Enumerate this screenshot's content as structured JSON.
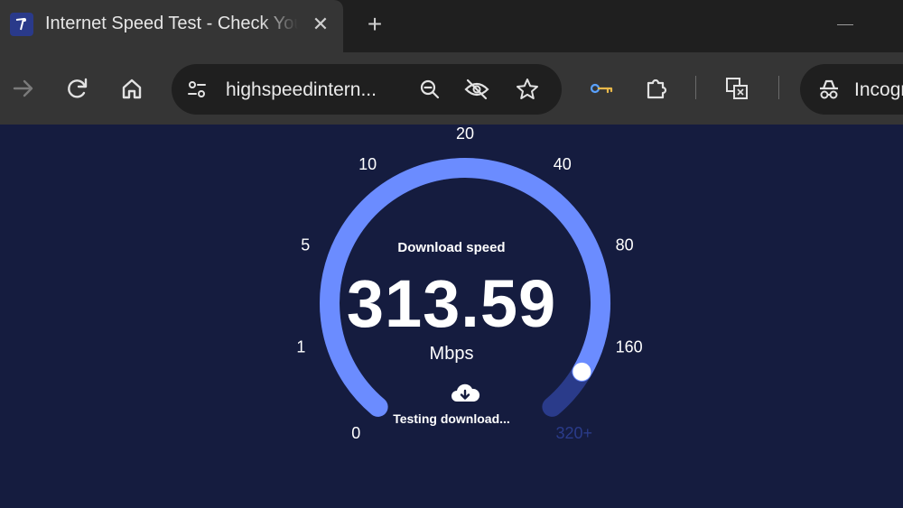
{
  "browser": {
    "tab": {
      "title": "Internet Speed Test - Check Your",
      "close_glyph": "✕"
    },
    "new_tab_glyph": "+",
    "address_bar": {
      "url": "highspeedintern..."
    },
    "incognito_label": "Incognito"
  },
  "speed_test": {
    "label": "Download speed",
    "value": "313.59",
    "unit": "Mbps",
    "status": "Testing download...",
    "scale_labels": [
      "0",
      "1",
      "5",
      "10",
      "20",
      "40",
      "80",
      "160",
      "320+"
    ],
    "progress_fraction": 0.93,
    "colors": {
      "background": "#151c3f",
      "arc_fill": "#6b8cff",
      "arc_track": "#2a3b8a",
      "text": "#ffffff",
      "dim_label": "#2a3b8a"
    }
  }
}
